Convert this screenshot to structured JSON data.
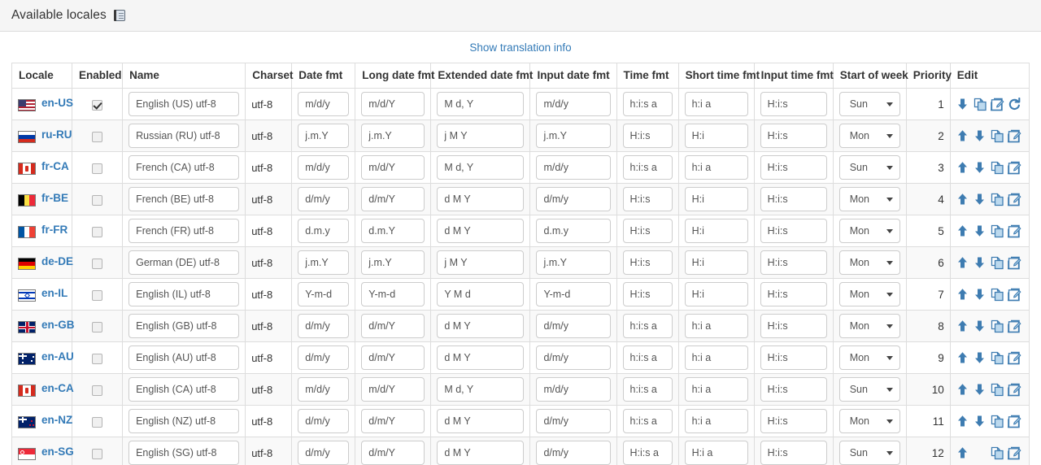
{
  "panel": {
    "title": "Available locales",
    "icon": "book-icon"
  },
  "translation_link": "Show translation info",
  "table": {
    "columns": [
      "Locale",
      "Enabled",
      "Name",
      "Charset",
      "Date fmt",
      "Long date fmt",
      "Extended date fmt",
      "Input date fmt",
      "Time fmt",
      "Short time fmt",
      "Input time fmt",
      "Start of week",
      "Priority",
      "Edit"
    ],
    "week_options": [
      "Sun",
      "Mon"
    ],
    "rows": [
      {
        "locale": "en-US",
        "flag": "us",
        "enabled": true,
        "name": "English (US) utf-8",
        "charset": "utf-8",
        "date_fmt": "m/d/y",
        "long_date_fmt": "m/d/Y",
        "ext_date_fmt": "M d, Y",
        "input_date_fmt": "m/d/y",
        "time_fmt": "h:i:s a",
        "short_time_fmt": "h:i a",
        "input_time_fmt": "H:i:s",
        "start_of_week": "Sun",
        "priority": "1",
        "actions": [
          "down-arrow-icon",
          "copy-icon",
          "edit-icon",
          "refresh-icon"
        ]
      },
      {
        "locale": "ru-RU",
        "flag": "ru",
        "enabled": false,
        "name": "Russian (RU) utf-8",
        "charset": "utf-8",
        "date_fmt": "j.m.Y",
        "long_date_fmt": "j.m.Y",
        "ext_date_fmt": "j M Y",
        "input_date_fmt": "j.m.Y",
        "time_fmt": "H:i:s",
        "short_time_fmt": "H:i",
        "input_time_fmt": "H:i:s",
        "start_of_week": "Mon",
        "priority": "2",
        "actions": [
          "up-arrow-icon",
          "down-arrow-icon",
          "copy-icon",
          "edit-icon"
        ]
      },
      {
        "locale": "fr-CA",
        "flag": "ca",
        "enabled": false,
        "name": "French (CA) utf-8",
        "charset": "utf-8",
        "date_fmt": "m/d/y",
        "long_date_fmt": "m/d/Y",
        "ext_date_fmt": "M d, Y",
        "input_date_fmt": "m/d/y",
        "time_fmt": "h:i:s a",
        "short_time_fmt": "h:i a",
        "input_time_fmt": "H:i:s",
        "start_of_week": "Sun",
        "priority": "3",
        "actions": [
          "up-arrow-icon",
          "down-arrow-icon",
          "copy-icon",
          "edit-icon"
        ]
      },
      {
        "locale": "fr-BE",
        "flag": "be",
        "enabled": false,
        "name": "French (BE) utf-8",
        "charset": "utf-8",
        "date_fmt": "d/m/y",
        "long_date_fmt": "d/m/Y",
        "ext_date_fmt": "d M Y",
        "input_date_fmt": "d/m/y",
        "time_fmt": "H:i:s",
        "short_time_fmt": "H:i",
        "input_time_fmt": "H:i:s",
        "start_of_week": "Mon",
        "priority": "4",
        "actions": [
          "up-arrow-icon",
          "down-arrow-icon",
          "copy-icon",
          "edit-icon"
        ]
      },
      {
        "locale": "fr-FR",
        "flag": "fr",
        "enabled": false,
        "name": "French (FR) utf-8",
        "charset": "utf-8",
        "date_fmt": "d.m.y",
        "long_date_fmt": "d.m.Y",
        "ext_date_fmt": "d M Y",
        "input_date_fmt": "d.m.y",
        "time_fmt": "H:i:s",
        "short_time_fmt": "H:i",
        "input_time_fmt": "H:i:s",
        "start_of_week": "Mon",
        "priority": "5",
        "actions": [
          "up-arrow-icon",
          "down-arrow-icon",
          "copy-icon",
          "edit-icon"
        ]
      },
      {
        "locale": "de-DE",
        "flag": "de",
        "enabled": false,
        "name": "German (DE) utf-8",
        "charset": "utf-8",
        "date_fmt": "j.m.Y",
        "long_date_fmt": "j.m.Y",
        "ext_date_fmt": "j M Y",
        "input_date_fmt": "j.m.Y",
        "time_fmt": "H:i:s",
        "short_time_fmt": "H:i",
        "input_time_fmt": "H:i:s",
        "start_of_week": "Mon",
        "priority": "6",
        "actions": [
          "up-arrow-icon",
          "down-arrow-icon",
          "copy-icon",
          "edit-icon"
        ]
      },
      {
        "locale": "en-IL",
        "flag": "il",
        "enabled": false,
        "name": "English (IL) utf-8",
        "charset": "utf-8",
        "date_fmt": "Y-m-d",
        "long_date_fmt": "Y-m-d",
        "ext_date_fmt": "Y M d",
        "input_date_fmt": "Y-m-d",
        "time_fmt": "H:i:s",
        "short_time_fmt": "H:i",
        "input_time_fmt": "H:i:s",
        "start_of_week": "Mon",
        "priority": "7",
        "actions": [
          "up-arrow-icon",
          "down-arrow-icon",
          "copy-icon",
          "edit-icon"
        ]
      },
      {
        "locale": "en-GB",
        "flag": "gb",
        "enabled": false,
        "name": "English (GB) utf-8",
        "charset": "utf-8",
        "date_fmt": "d/m/y",
        "long_date_fmt": "d/m/Y",
        "ext_date_fmt": "d M Y",
        "input_date_fmt": "d/m/y",
        "time_fmt": "h:i:s a",
        "short_time_fmt": "h:i a",
        "input_time_fmt": "H:i:s",
        "start_of_week": "Mon",
        "priority": "8",
        "actions": [
          "up-arrow-icon",
          "down-arrow-icon",
          "copy-icon",
          "edit-icon"
        ]
      },
      {
        "locale": "en-AU",
        "flag": "au",
        "enabled": false,
        "name": "English (AU) utf-8",
        "charset": "utf-8",
        "date_fmt": "d/m/y",
        "long_date_fmt": "d/m/Y",
        "ext_date_fmt": "d M Y",
        "input_date_fmt": "d/m/y",
        "time_fmt": "h:i:s a",
        "short_time_fmt": "h:i a",
        "input_time_fmt": "H:i:s",
        "start_of_week": "Mon",
        "priority": "9",
        "actions": [
          "up-arrow-icon",
          "down-arrow-icon",
          "copy-icon",
          "edit-icon"
        ]
      },
      {
        "locale": "en-CA",
        "flag": "ca",
        "enabled": false,
        "name": "English (CA) utf-8",
        "charset": "utf-8",
        "date_fmt": "m/d/y",
        "long_date_fmt": "m/d/Y",
        "ext_date_fmt": "M d, Y",
        "input_date_fmt": "m/d/y",
        "time_fmt": "h:i:s a",
        "short_time_fmt": "h:i a",
        "input_time_fmt": "H:i:s",
        "start_of_week": "Sun",
        "priority": "10",
        "actions": [
          "up-arrow-icon",
          "down-arrow-icon",
          "copy-icon",
          "edit-icon"
        ]
      },
      {
        "locale": "en-NZ",
        "flag": "nz",
        "enabled": false,
        "name": "English (NZ) utf-8",
        "charset": "utf-8",
        "date_fmt": "d/m/y",
        "long_date_fmt": "d/m/Y",
        "ext_date_fmt": "d M Y",
        "input_date_fmt": "d/m/y",
        "time_fmt": "h:i:s a",
        "short_time_fmt": "h:i a",
        "input_time_fmt": "H:i:s",
        "start_of_week": "Mon",
        "priority": "11",
        "actions": [
          "up-arrow-icon",
          "down-arrow-icon",
          "copy-icon",
          "edit-icon"
        ]
      },
      {
        "locale": "en-SG",
        "flag": "sg",
        "enabled": false,
        "name": "English (SG) utf-8",
        "charset": "utf-8",
        "date_fmt": "d/m/y",
        "long_date_fmt": "d/m/Y",
        "ext_date_fmt": "d M Y",
        "input_date_fmt": "d/m/y",
        "time_fmt": "H:i:s a",
        "short_time_fmt": "H:i a",
        "input_time_fmt": "H:i:s",
        "start_of_week": "Sun",
        "priority": "12",
        "actions": [
          "up-arrow-icon",
          "spacer",
          "copy-icon",
          "edit-icon"
        ]
      }
    ]
  },
  "colors": {
    "link": "#337ab7",
    "icon_blue": "#3e7cb1",
    "panel_bg": "#f5f5f5",
    "border": "#dddddd",
    "stripe": "#f9f9f9"
  }
}
